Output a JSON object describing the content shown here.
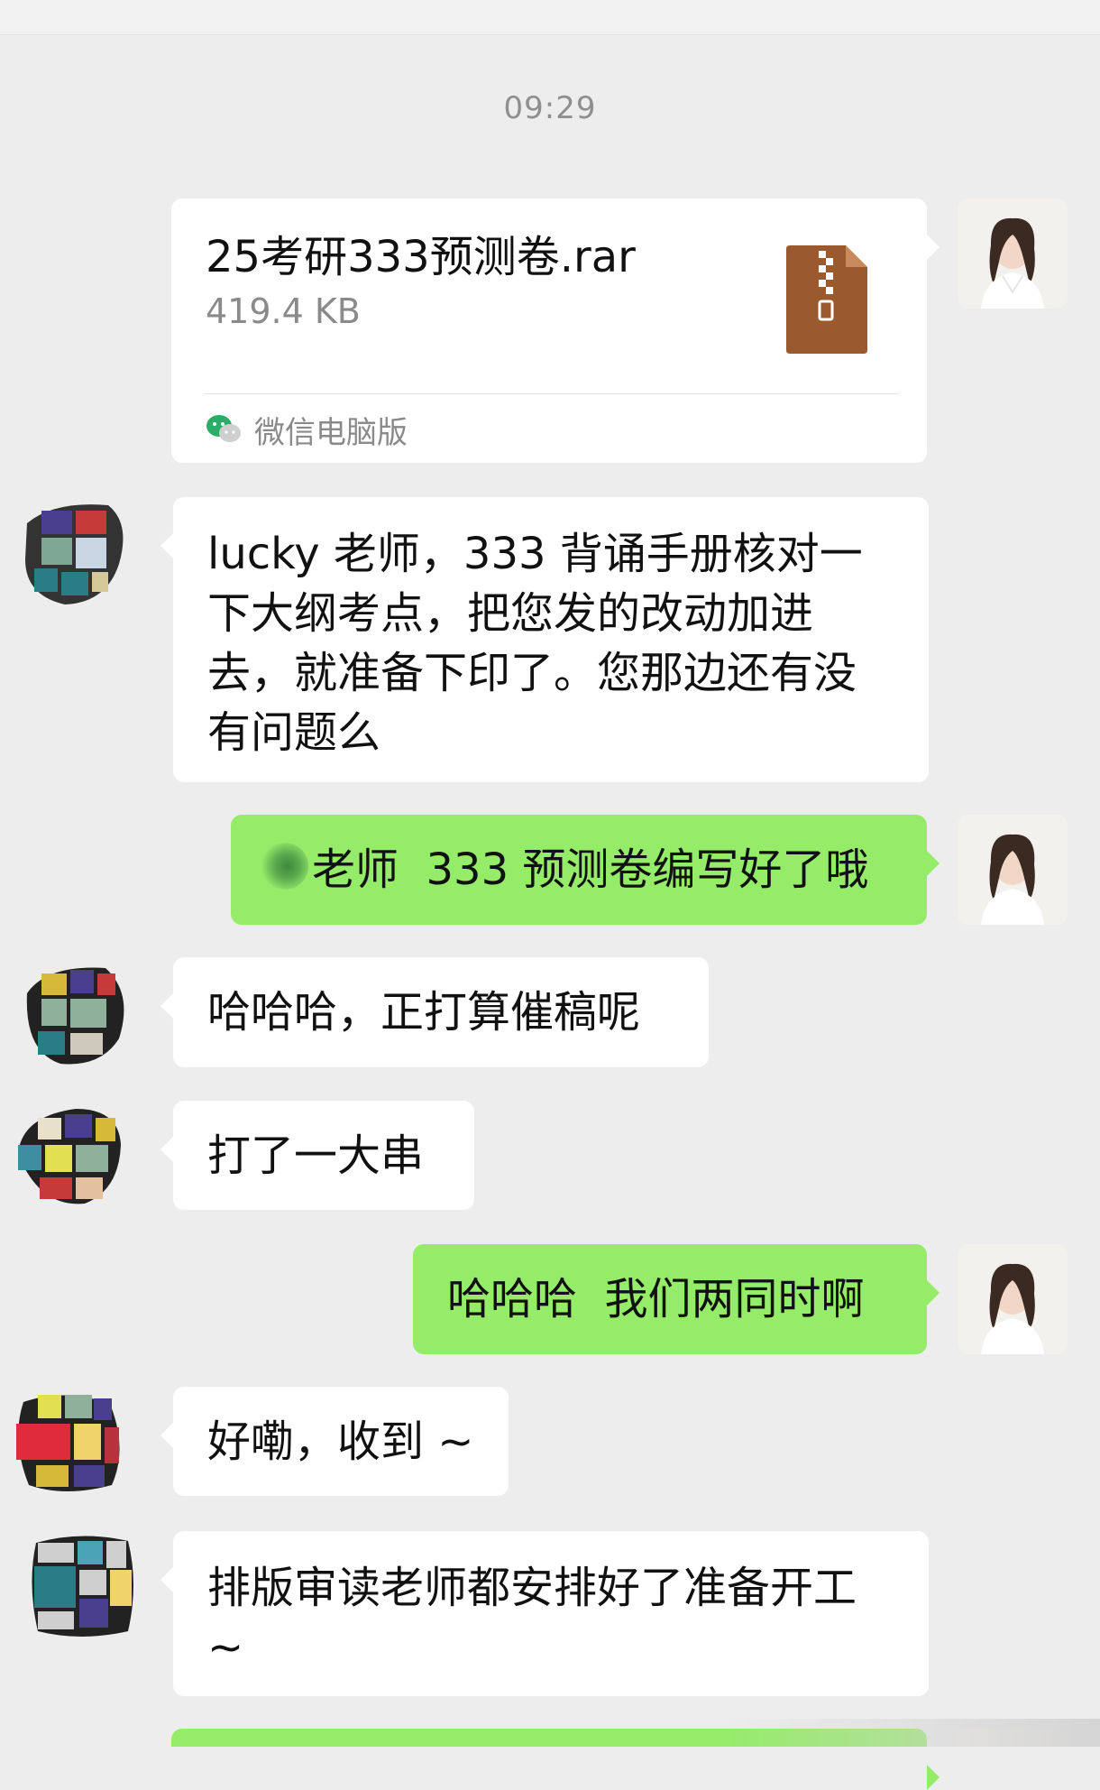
{
  "time": "09:29",
  "file_message": {
    "name": "25考研333预测卷.rar",
    "size": "419.4 KB",
    "source": "微信电脑版",
    "file_icon": "zip-file-icon",
    "source_icon": "wechat-icon"
  },
  "messages": [
    {
      "side": "in",
      "text": "lucky 老师，333 背诵手册核对一下大纲考点，把您发的改动加进去，就准备下印了。您那边还有没有问题么"
    },
    {
      "side": "out",
      "text": "老师  333 预测卷编写好了哦"
    },
    {
      "side": "in",
      "text": "哈哈哈，正打算催稿呢"
    },
    {
      "side": "in",
      "text": "打了一大串"
    },
    {
      "side": "out",
      "text": "哈哈哈  我们两同时啊"
    },
    {
      "side": "in",
      "text": "好嘞，收到 ~"
    },
    {
      "side": "in",
      "text": "排版审读老师都安排好了准备开工 ~"
    }
  ],
  "colors": {
    "background": "#ededed",
    "incoming_bubble": "#ffffff",
    "outgoing_bubble": "#95ec69",
    "time_text": "#8f8f8f",
    "zip_icon": "#9b5a2e"
  }
}
